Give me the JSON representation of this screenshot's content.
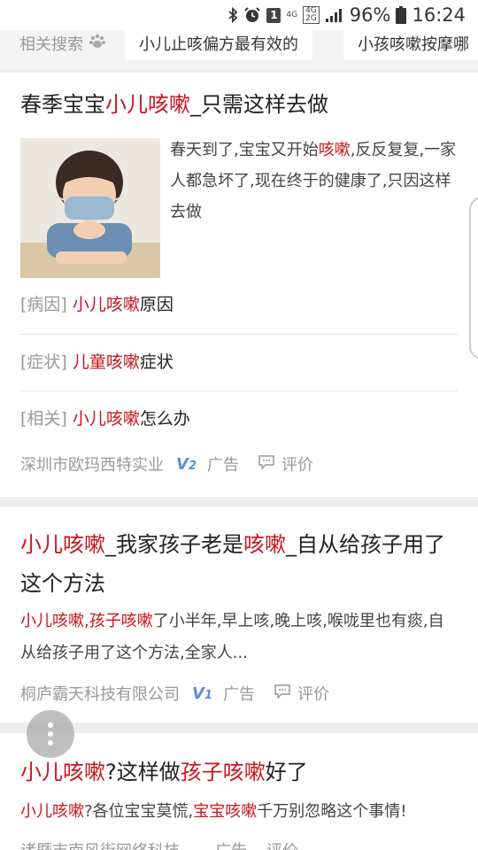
{
  "status_bar": {
    "battery": "96%",
    "time": "16:24",
    "sim_badge": "1",
    "network_top": "4G",
    "network_mid": "4G",
    "network_bot": "2G"
  },
  "related_search": {
    "label": "相关搜索",
    "chips": [
      "小儿止咳偏方最有效的",
      "小孩咳嗽按摩哪"
    ]
  },
  "results": [
    {
      "title_parts": [
        "春季宝宝",
        "小儿咳嗽",
        "_只需这样去做"
      ],
      "description_parts": [
        "春天到了,宝宝又开始",
        "咳嗽",
        ",反反复复,一家人都急坏了,现在终于的健康了,只因这样去做"
      ],
      "links": [
        {
          "tag": "[病因]",
          "hl": "小儿咳嗽",
          "rest": "原因"
        },
        {
          "tag": "[症状]",
          "hl": "儿童咳嗽",
          "rest": "症状"
        },
        {
          "tag": "[相关]",
          "hl": "小儿咳嗽",
          "rest": "怎么办"
        }
      ],
      "source": "深圳市欧玛西特实业",
      "vlevel": "V",
      "vnum": "2",
      "ad_label": "广告",
      "comment_label": "评价"
    },
    {
      "title_parts": [
        "小儿咳嗽",
        "_我家孩子老是",
        "咳嗽",
        "_自从给孩子用了这个方法"
      ],
      "snippet_parts": [
        "小儿咳嗽",
        ",",
        "孩子咳嗽",
        "了小半年,早上咳,晚上咳,喉咙里也有痰,自从给孩子用了这个方法,全家人..."
      ],
      "source": "桐庐霸天科技有限公司",
      "vlevel": "V",
      "vnum": "1",
      "ad_label": "广告",
      "comment_label": "评价"
    },
    {
      "title_parts": [
        "小儿咳嗽",
        "?这样做",
        "孩子咳嗽",
        "好了"
      ],
      "snippet_parts": [
        "小儿咳嗽",
        "?各位宝宝莫慌,",
        "宝宝咳嗽",
        "千万别忽略这个事情!"
      ],
      "source": "诸暨市南风街网络科技",
      "ad_label": "广告",
      "comment_label": "评价"
    }
  ],
  "colors": {
    "highlight": "#c9141b",
    "muted": "#999999",
    "vbadge": "#5b8fd6"
  }
}
